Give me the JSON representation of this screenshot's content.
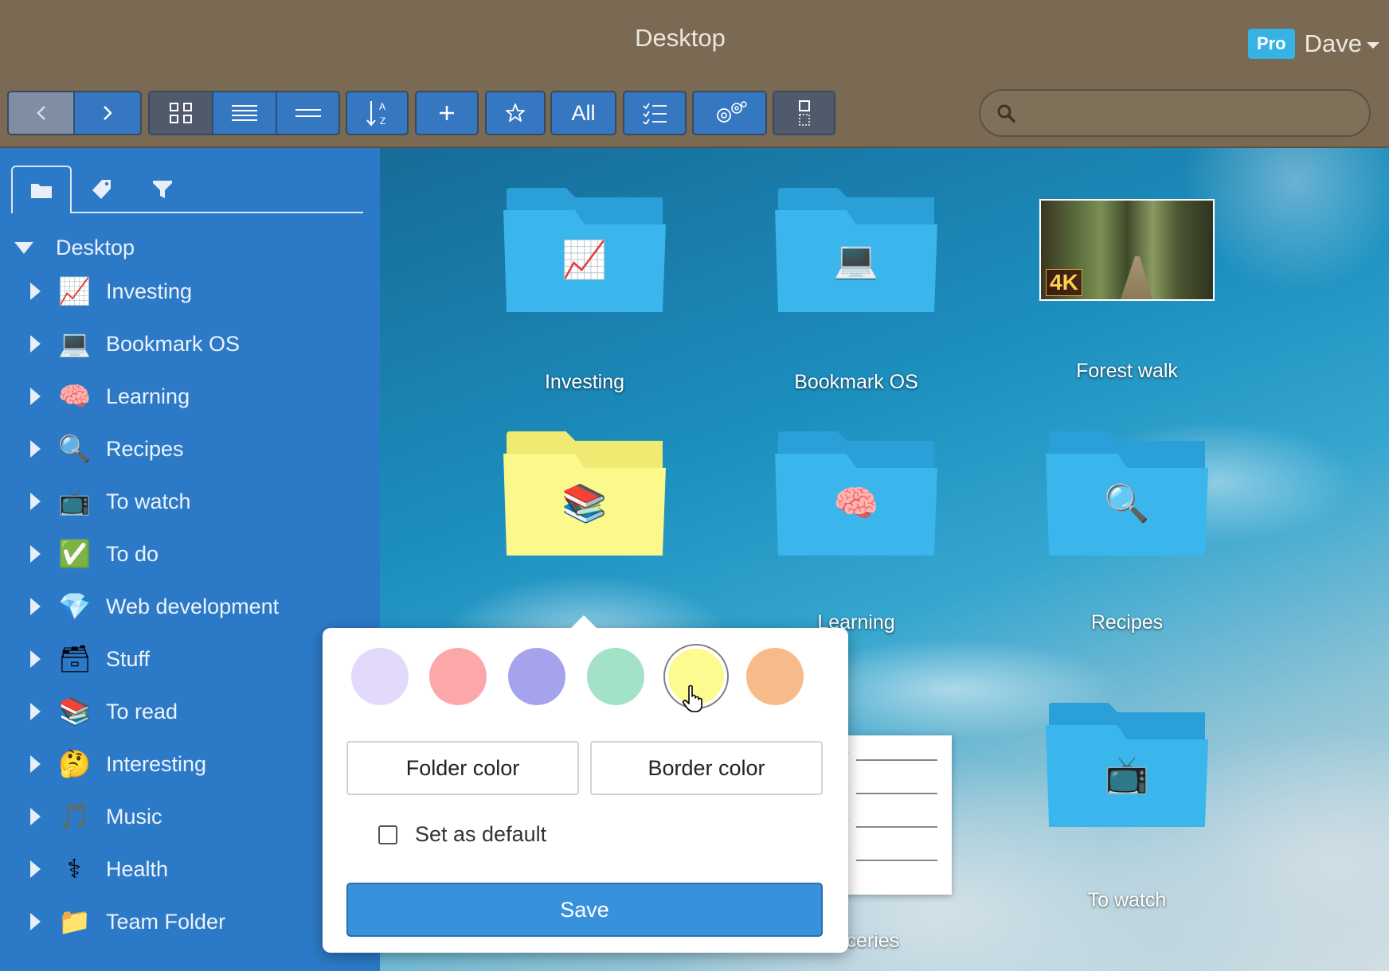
{
  "window": {
    "title": "Desktop"
  },
  "user": {
    "badge": "Pro",
    "name": "Dave"
  },
  "toolbar": {
    "all_label": "All",
    "buttons": [
      "back-icon",
      "forward-icon",
      "grid-view-icon",
      "list-view-icon",
      "compact-view-icon",
      "sort-az-icon",
      "add-icon",
      "star-icon",
      "all",
      "checklist-icon",
      "settings-icon",
      "layout-icon"
    ]
  },
  "search": {
    "placeholder": "",
    "value": ""
  },
  "sidebar": {
    "tabs": [
      "folder-icon",
      "tag-icon",
      "filter-icon"
    ],
    "root": "Desktop",
    "items": [
      {
        "label": "Investing",
        "icon": "chart-increasing-icon",
        "glyph": "📈"
      },
      {
        "label": "Bookmark OS",
        "icon": "laptop-icon",
        "glyph": "💻"
      },
      {
        "label": "Learning",
        "icon": "brain-icon",
        "glyph": "🧠"
      },
      {
        "label": "Recipes",
        "icon": "magnifier-icon",
        "glyph": "🔍"
      },
      {
        "label": "To watch",
        "icon": "television-icon",
        "glyph": "📺"
      },
      {
        "label": "To do",
        "icon": "check-mark-icon",
        "glyph": "✅"
      },
      {
        "label": "Web development",
        "icon": "gem-icon",
        "glyph": "💎"
      },
      {
        "label": "Stuff",
        "icon": "card-file-box-icon",
        "glyph": "🗃"
      },
      {
        "label": "To read",
        "icon": "books-icon",
        "glyph": "📚"
      },
      {
        "label": "Interesting",
        "icon": "thinking-face-icon",
        "glyph": "🤔"
      },
      {
        "label": "Music",
        "icon": "musical-note-icon",
        "glyph": "🎵"
      },
      {
        "label": "Health",
        "icon": "caduceus-icon",
        "glyph": "⚕"
      },
      {
        "label": "Team Folder",
        "icon": "folder-icon",
        "glyph": "📁"
      }
    ]
  },
  "desktop": {
    "tiles": [
      {
        "label": "Investing",
        "kind": "folder",
        "color": "blue",
        "glyph": "📈"
      },
      {
        "label": "Bookmark OS",
        "kind": "folder",
        "color": "blue",
        "glyph": "💻"
      },
      {
        "label": "Forest walk",
        "kind": "video",
        "badge": "4K"
      },
      {
        "label": "",
        "kind": "folder",
        "color": "yellow",
        "glyph": "📚"
      },
      {
        "label": "Learning",
        "kind": "folder",
        "color": "blue",
        "glyph": "🧠"
      },
      {
        "label": "Recipes",
        "kind": "folder",
        "color": "blue",
        "glyph": "🔍"
      },
      {
        "label": "Groceries",
        "kind": "note"
      },
      {
        "label": "To watch",
        "kind": "folder",
        "color": "blue",
        "glyph": "📺"
      }
    ]
  },
  "color_popover": {
    "swatches": [
      "#e3dafb",
      "#fca7a9",
      "#a6a3ee",
      "#a3e2c6",
      "#fbfb8f",
      "#f7bb8a"
    ],
    "selected_swatch": "#fbfb8f",
    "folder_color_label": "Folder color",
    "border_color_label": "Border color",
    "default_checkbox_label": "Set as default",
    "default_checked": false,
    "save_label": "Save"
  },
  "colors": {
    "toolbar_bg": "#7a6a53",
    "sidebar_bg": "#2c7ac7",
    "accent": "#3891dd",
    "folder_blue": "#3bb6ec"
  }
}
